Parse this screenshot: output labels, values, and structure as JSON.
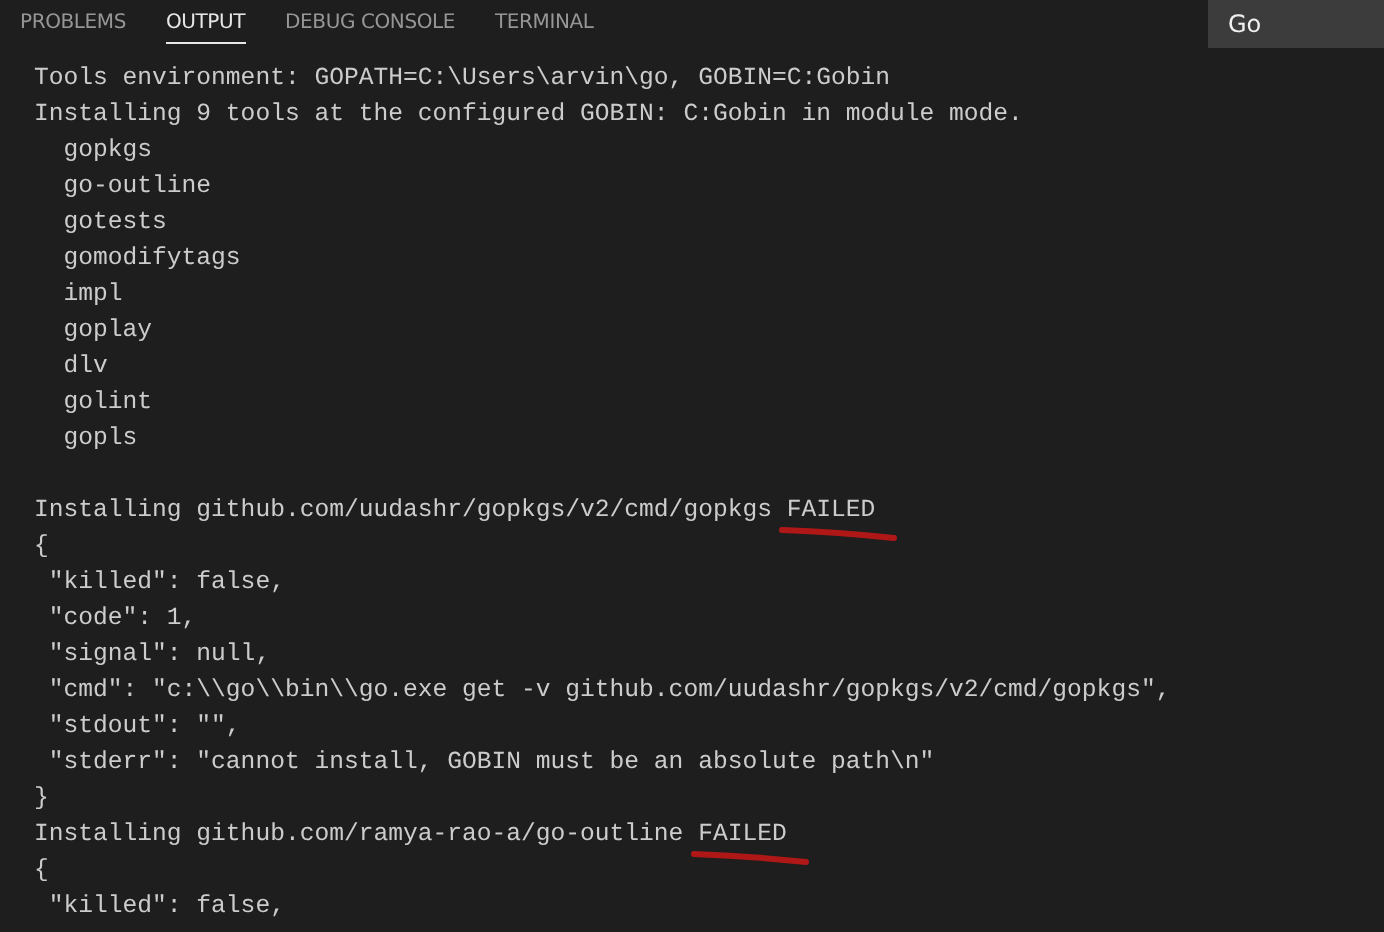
{
  "panel_tabs": [
    {
      "label": "PROBLEMS",
      "selected": false
    },
    {
      "label": "OUTPUT",
      "selected": true
    },
    {
      "label": "DEBUG CONSOLE",
      "selected": false
    },
    {
      "label": "TERMINAL",
      "selected": false
    }
  ],
  "channel_select": {
    "value": "Go"
  },
  "output_lines": [
    {
      "kind": "text",
      "text": "Tools environment: GOPATH=C:\\Users\\arvin\\go, GOBIN=C:Gobin"
    },
    {
      "kind": "text",
      "text": "Installing 9 tools at the configured GOBIN: C:Gobin in module mode."
    },
    {
      "kind": "text",
      "text": "  gopkgs"
    },
    {
      "kind": "text",
      "text": "  go-outline"
    },
    {
      "kind": "text",
      "text": "  gotests"
    },
    {
      "kind": "text",
      "text": "  gomodifytags"
    },
    {
      "kind": "text",
      "text": "  impl"
    },
    {
      "kind": "text",
      "text": "  goplay"
    },
    {
      "kind": "text",
      "text": "  dlv"
    },
    {
      "kind": "text",
      "text": "  golint"
    },
    {
      "kind": "text",
      "text": "  gopls"
    },
    {
      "kind": "blank"
    },
    {
      "kind": "status",
      "text": "Installing github.com/uudashr/gopkgs/v2/cmd/gopkgs",
      "status": "FAILED",
      "underlined": true
    },
    {
      "kind": "text",
      "text": "{"
    },
    {
      "kind": "text",
      "text": " \"killed\": false,"
    },
    {
      "kind": "text",
      "text": " \"code\": 1,"
    },
    {
      "kind": "text",
      "text": " \"signal\": null,"
    },
    {
      "kind": "text",
      "text": " \"cmd\": \"c:\\\\go\\\\bin\\\\go.exe get -v github.com/uudashr/gopkgs/v2/cmd/gopkgs\","
    },
    {
      "kind": "text",
      "text": " \"stdout\": \"\","
    },
    {
      "kind": "text",
      "text": " \"stderr\": \"cannot install, GOBIN must be an absolute path\\n\""
    },
    {
      "kind": "text",
      "text": "}"
    },
    {
      "kind": "status",
      "text": "Installing github.com/ramya-rao-a/go-outline",
      "status": "FAILED",
      "underlined": true
    },
    {
      "kind": "text",
      "text": "{"
    },
    {
      "kind": "text",
      "text": " \"killed\": false,"
    }
  ]
}
